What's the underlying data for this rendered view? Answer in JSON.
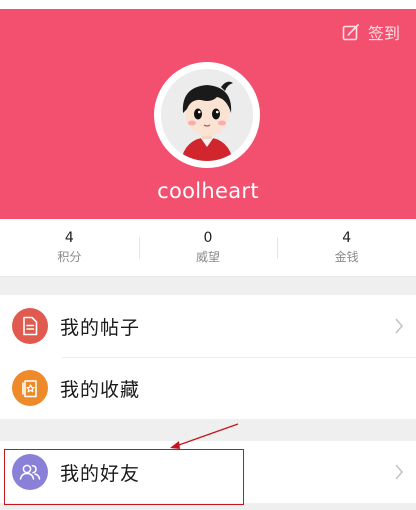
{
  "header": {
    "checkin_label": "签到",
    "username": "coolheart",
    "bg_color": "#f2506e"
  },
  "stats": [
    {
      "value": "4",
      "label": "积分"
    },
    {
      "value": "0",
      "label": "威望"
    },
    {
      "value": "4",
      "label": "金钱"
    }
  ],
  "menu": {
    "group1": [
      {
        "label": "我的帖子",
        "icon": "document-icon",
        "color": "#e05a4f"
      },
      {
        "label": "我的收藏",
        "icon": "bookmark-star-icon",
        "color": "#ef8a2a"
      }
    ],
    "group2": [
      {
        "label": "我的好友",
        "icon": "friends-icon",
        "color": "#8b80d8"
      }
    ]
  },
  "annotation": {
    "highlight_color": "#c4161c"
  }
}
